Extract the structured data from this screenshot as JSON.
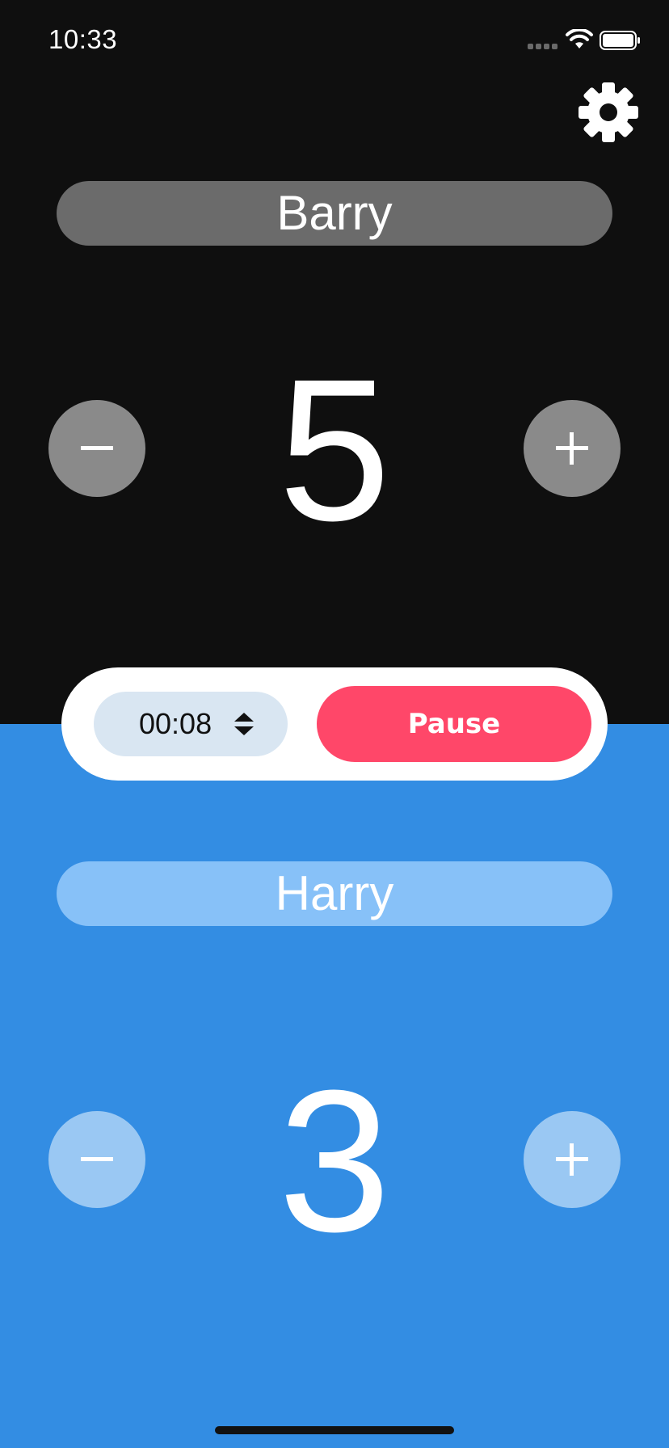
{
  "status_bar": {
    "time": "10:33",
    "signal_icon": "cellular-dots-icon",
    "wifi_icon": "wifi-icon",
    "battery_icon": "battery-icon"
  },
  "settings": {
    "icon": "gear-icon"
  },
  "players": {
    "top": {
      "name": "Barry",
      "score": "5",
      "background": "#0f0f0f",
      "pill_color": "#6b6b6b",
      "button_color": "#8a8a8a",
      "minus_icon": "minus-icon",
      "plus_icon": "plus-icon"
    },
    "bottom": {
      "name": "Harry",
      "score": "3",
      "background": "#338de3",
      "pill_color": "#87c1f8",
      "button_color": "#9ac8f3",
      "minus_icon": "minus-icon",
      "plus_icon": "plus-icon"
    }
  },
  "controls": {
    "timer": "00:08",
    "timer_icon": "sort-arrows-icon",
    "pause_label": "Pause",
    "pause_color": "#ff4769"
  }
}
